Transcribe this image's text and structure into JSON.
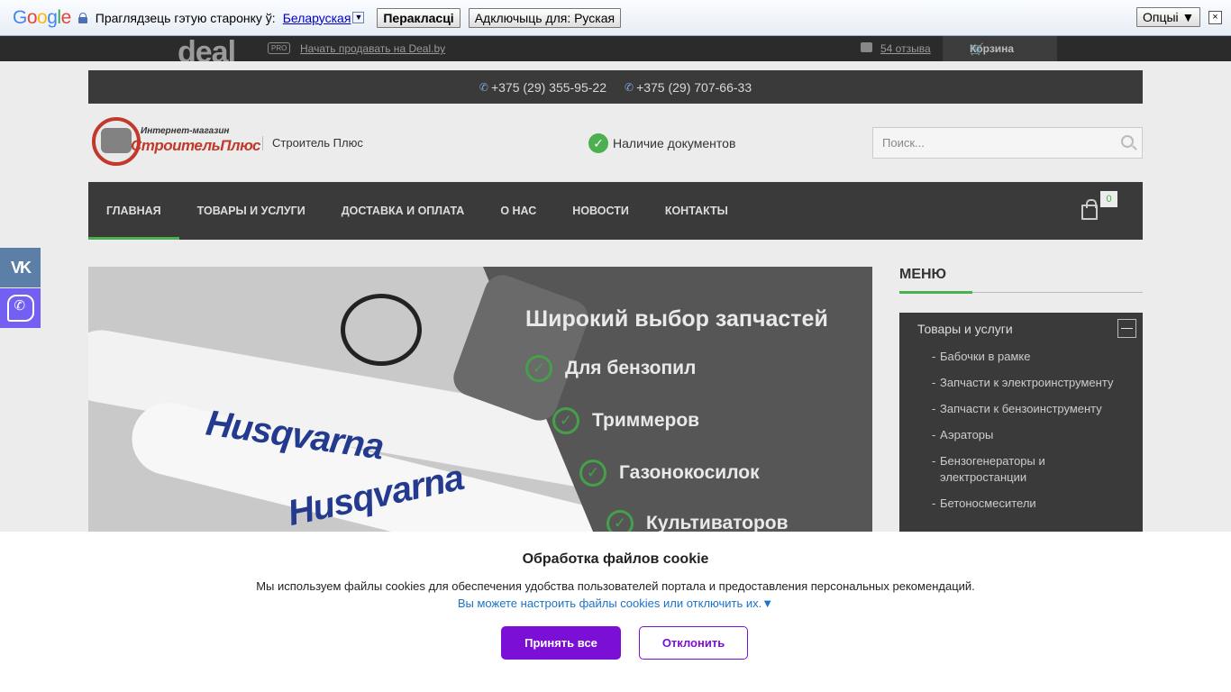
{
  "translate_bar": {
    "logo": "Google",
    "prompt": "Праглядзець гэтую старонку ў:",
    "language": "Беларуская",
    "translate_button": "Перакласці",
    "disable_button": "Адключыць для: Руская",
    "options_button": "Опцыі ▼",
    "close": "×"
  },
  "deal_bar": {
    "logo": "deal",
    "pro_badge": "PRO",
    "sell_link": "Начать продавать на Deal.by",
    "reviews_link": "54 отзыва",
    "cart_label": "Корзина"
  },
  "site": {
    "phones": [
      "+375 (29) 355-95-22",
      "+375 (29) 707-66-33"
    ],
    "logo_small": "Интернет-магазин",
    "logo_name": "СтроительПлюс",
    "shop_name": "Строитель Плюс",
    "documents_label": "Наличие документов",
    "search_placeholder": "Поиск...",
    "nav": [
      {
        "label": "Главная",
        "active": true
      },
      {
        "label": "Товары и услуги",
        "active": false
      },
      {
        "label": "Доставка и оплата",
        "active": false
      },
      {
        "label": "О нас",
        "active": false
      },
      {
        "label": "Новости",
        "active": false
      },
      {
        "label": "Контакты",
        "active": false
      }
    ],
    "cart_count": "0",
    "social": {
      "vk": "VK"
    }
  },
  "banner": {
    "title": "Широкий выбор запчастей",
    "lines": [
      "Для бензопил",
      "Триммеров",
      "Газонокосилок",
      "Культиваторов"
    ],
    "brand_text": "Husqvarna"
  },
  "menu": {
    "title": "МЕНЮ",
    "head": "Товары и услуги",
    "items": [
      "Бабочки в рамке",
      "Запчасти к электроинструменту",
      "Запчасти к бензоинструменту",
      "Аэраторы",
      "Бензогенераторы и электростанции",
      "Бетоносмесители"
    ]
  },
  "cookie": {
    "title": "Обработка файлов cookie",
    "text": "Мы используем файлы cookies для обеспечения удобства пользователей портала и предоставления персональных рекомендаций.",
    "link": "Вы можете настроить файлы cookies или отключить их.▼",
    "accept": "Принять все",
    "decline": "Отклонить"
  },
  "colors": {
    "accent_green": "#4caf50",
    "cookie_purple": "#7b0fd6",
    "dark_panel": "#3a3a3a"
  }
}
